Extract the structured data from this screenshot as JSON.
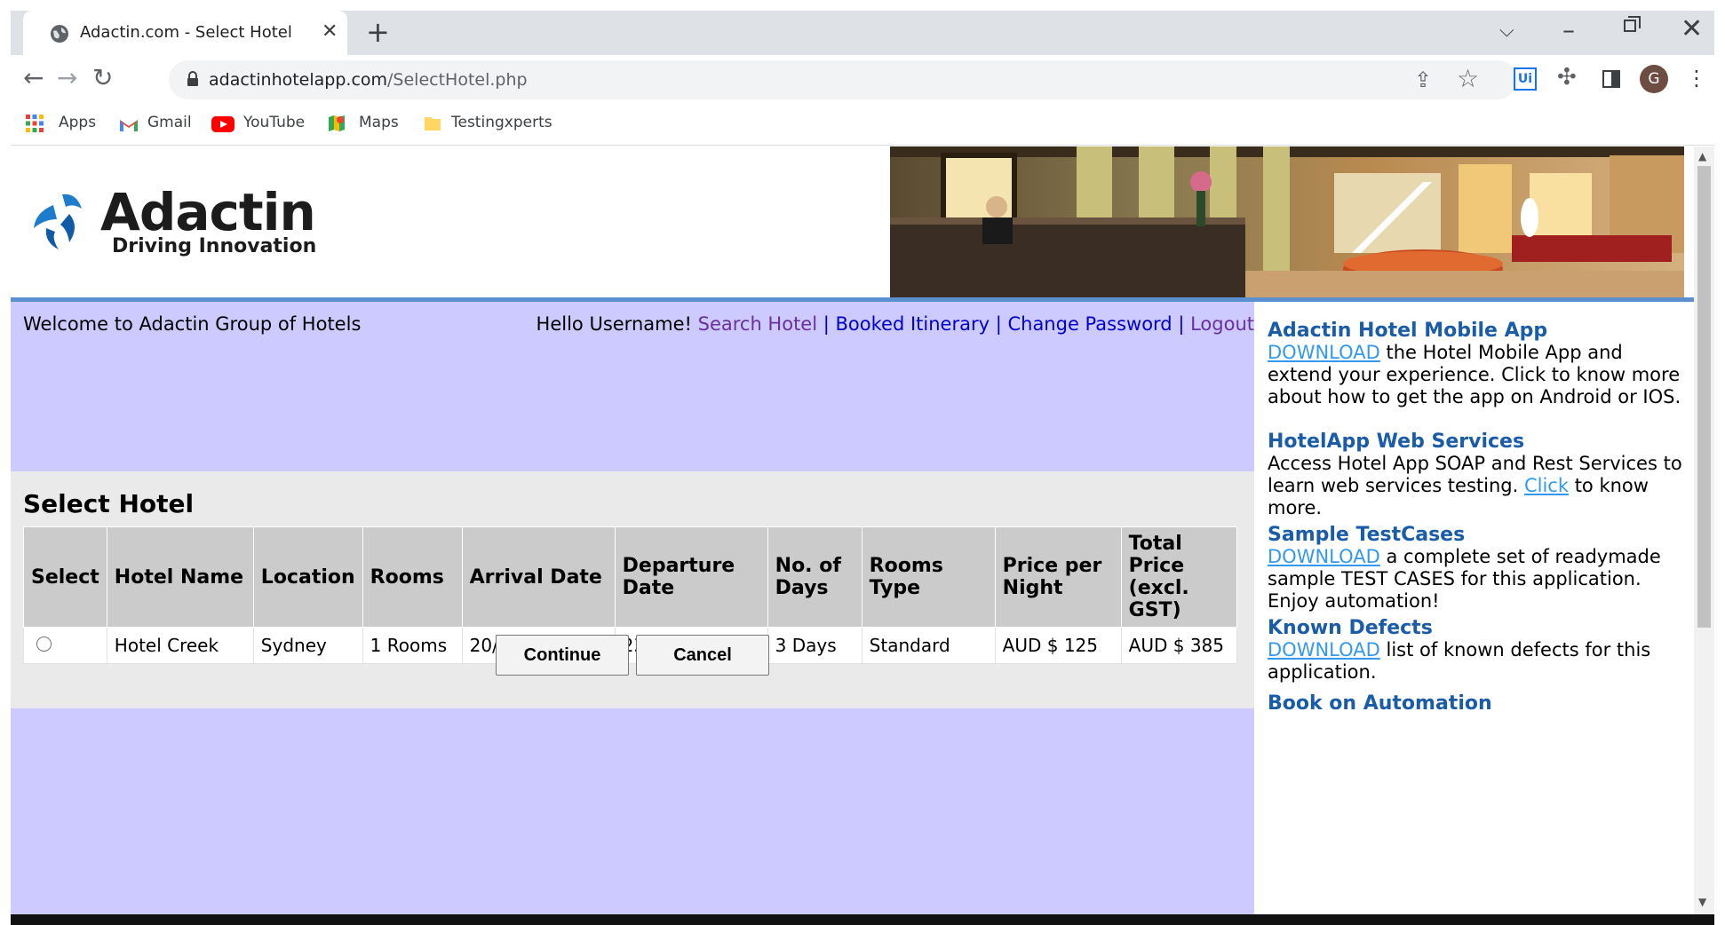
{
  "browser": {
    "tab_title": "Adactin.com - Select Hotel",
    "url_domain": "adactinhotelapp.com",
    "url_path": "/SelectHotel.php",
    "profile_initial": "G",
    "extension_label": "Ui",
    "bookmarks": [
      {
        "label": "Apps",
        "icon": "apps-grid-icon"
      },
      {
        "label": "Gmail",
        "icon": "gmail-icon"
      },
      {
        "label": "YouTube",
        "icon": "youtube-icon"
      },
      {
        "label": "Maps",
        "icon": "maps-icon"
      },
      {
        "label": "Testingxperts",
        "icon": "folder-icon"
      }
    ]
  },
  "header": {
    "logo_name": "Adactin",
    "logo_tagline": "Driving Innovation"
  },
  "nav": {
    "welcome": "Welcome to Adactin Group of Hotels",
    "greeting": "Hello Username!",
    "search_hotel": "Search Hotel",
    "booked_itinerary": "Booked Itinerary",
    "change_password": "Change Password",
    "logout": "Logout",
    "separator": "|"
  },
  "select_hotel": {
    "title": "Select Hotel",
    "columns": [
      "Select",
      "Hotel Name",
      "Location",
      "Rooms",
      "Arrival Date",
      "Departure Date",
      "No. of Days",
      "Rooms Type",
      "Price per Night",
      "Total Price (excl. GST)"
    ],
    "row": {
      "hotel_name": "Hotel Creek",
      "location": "Sydney",
      "rooms": "1 Rooms",
      "arrival": "20/05/2022",
      "departure": "23/05/2022",
      "days": "3 Days",
      "room_type": "Standard",
      "price_per_night": "AUD $ 125",
      "total_price": "AUD $ 385"
    },
    "continue_label": "Continue",
    "cancel_label": "Cancel"
  },
  "sidebar": {
    "mobile_title": "Adactin Hotel Mobile App",
    "mobile_link": "DOWNLOAD",
    "mobile_text": " the Hotel Mobile App and extend your experience. Click to know more about how to get the app on Android or IOS.",
    "ws_title": "HotelApp Web Services",
    "ws_text_before": "Access Hotel App SOAP and Rest Services to learn web services testing. ",
    "ws_link": "Click",
    "ws_text_after": " to know more.",
    "tc_title": "Sample TestCases",
    "tc_link": "DOWNLOAD",
    "tc_text": " a complete set of readymade sample TEST CASES for this application. Enjoy automation!",
    "kd_title": "Known Defects",
    "kd_link": "DOWNLOAD",
    "kd_text": " list of known defects for this application.",
    "book_title": "Book on Automation"
  },
  "colors": {
    "lavender": "#cccaff",
    "panel_gray": "#eaeaea",
    "sidebar_title_blue": "#1a5ca8",
    "link_blue": "#3399ee"
  }
}
